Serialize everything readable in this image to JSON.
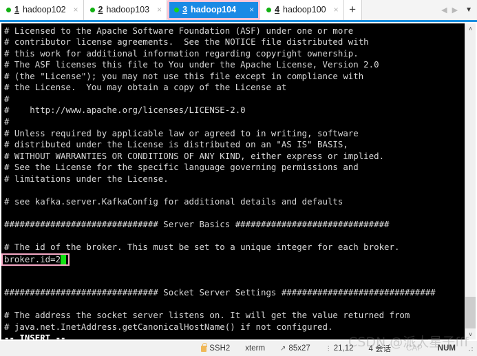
{
  "tabbar": {
    "tabs": [
      {
        "num": "1",
        "label": "hadoop102",
        "close": "×",
        "active": false
      },
      {
        "num": "2",
        "label": "hadoop103",
        "close": "×",
        "active": false
      },
      {
        "num": "3",
        "label": "hadoop104",
        "close": "×",
        "active": true
      },
      {
        "num": "4",
        "label": "hadoop100",
        "close": "×",
        "active": false
      }
    ],
    "add_label": "+",
    "nav_prev": "◀",
    "nav_next": "▶",
    "nav_dropdown": "▼"
  },
  "terminal": {
    "lines": [
      "# Licensed to the Apache Software Foundation (ASF) under one or more",
      "# contributor license agreements.  See the NOTICE file distributed with",
      "# this work for additional information regarding copyright ownership.",
      "# The ASF licenses this file to You under the Apache License, Version 2.0",
      "# (the \"License\"); you may not use this file except in compliance with",
      "# the License.  You may obtain a copy of the License at",
      "#",
      "#    http://www.apache.org/licenses/LICENSE-2.0",
      "#",
      "# Unless required by applicable law or agreed to in writing, software",
      "# distributed under the License is distributed on an \"AS IS\" BASIS,",
      "# WITHOUT WARRANTIES OR CONDITIONS OF ANY KIND, either express or implied.",
      "# See the License for the specific language governing permissions and",
      "# limitations under the License.",
      "",
      "# see kafka.server.KafkaConfig for additional details and defaults",
      "",
      "############################## Server Basics ##############################",
      "",
      "# The id of the broker. This must be set to a unique integer for each broker.",
      "",
      "",
      "############################## Socket Server Settings ##############################",
      "",
      "# The address the socket server listens on. It will get the value returned from",
      "# java.net.InetAddress.getCanonicalHostName() if not configured."
    ],
    "highlight_line": "broker.id=2",
    "highlight_index": 20,
    "cursor": " ",
    "mode_line": "-- INSERT --",
    "colors": {
      "background": "#000000",
      "foreground": "#d8d8d8",
      "cursor": "#14e014",
      "highlight_border": "#f7a9c6"
    }
  },
  "scrollbar": {
    "up_arrow": "∧",
    "down_arrow": "∨"
  },
  "statusbar": {
    "protocol": "SSH2",
    "terminal_type": "xterm",
    "size": "85x27",
    "position": "21,12",
    "sessions": "4 会话",
    "cap": "CAP",
    "num": "NUM"
  },
  "watermark": "CSDN @派大星子fff"
}
